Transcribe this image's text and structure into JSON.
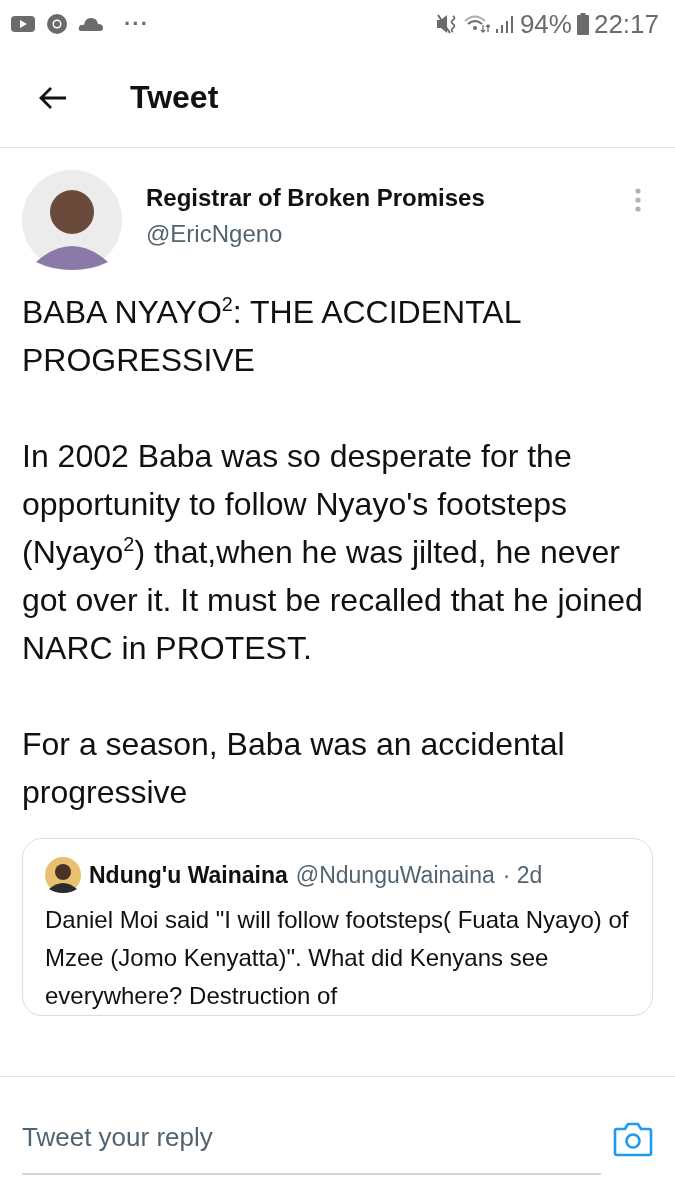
{
  "status_bar": {
    "battery": "94%",
    "time": "22:17",
    "more": "···"
  },
  "header": {
    "title": "Tweet"
  },
  "tweet": {
    "author": "Registrar of Broken Promises",
    "handle": "@EricNgeno",
    "paragraphs": [
      "BABA NYAYO$^{2}$: THE ACCIDENTAL PROGRESSIVE",
      "In 2002 Baba was so desperate for the opportunity to follow Nyayo's footsteps (Nyayo$^{2}$) that,when he was jilted, he never got over it. It must be recalled that he joined NARC in PROTEST.",
      "For a season, Baba was an accidental progressive"
    ],
    "quoted": {
      "author": "Ndung'u Wainaina",
      "handle": "@NdunguWainaina",
      "time": "· 2d",
      "text": "Daniel Moi said \"I will follow footsteps( Fuata Nyayo) of Mzee (Jomo Kenyatta)\". What did Kenyans see   everywhere? Destruction of"
    }
  },
  "reply_bar": {
    "placeholder": "Tweet your reply"
  }
}
